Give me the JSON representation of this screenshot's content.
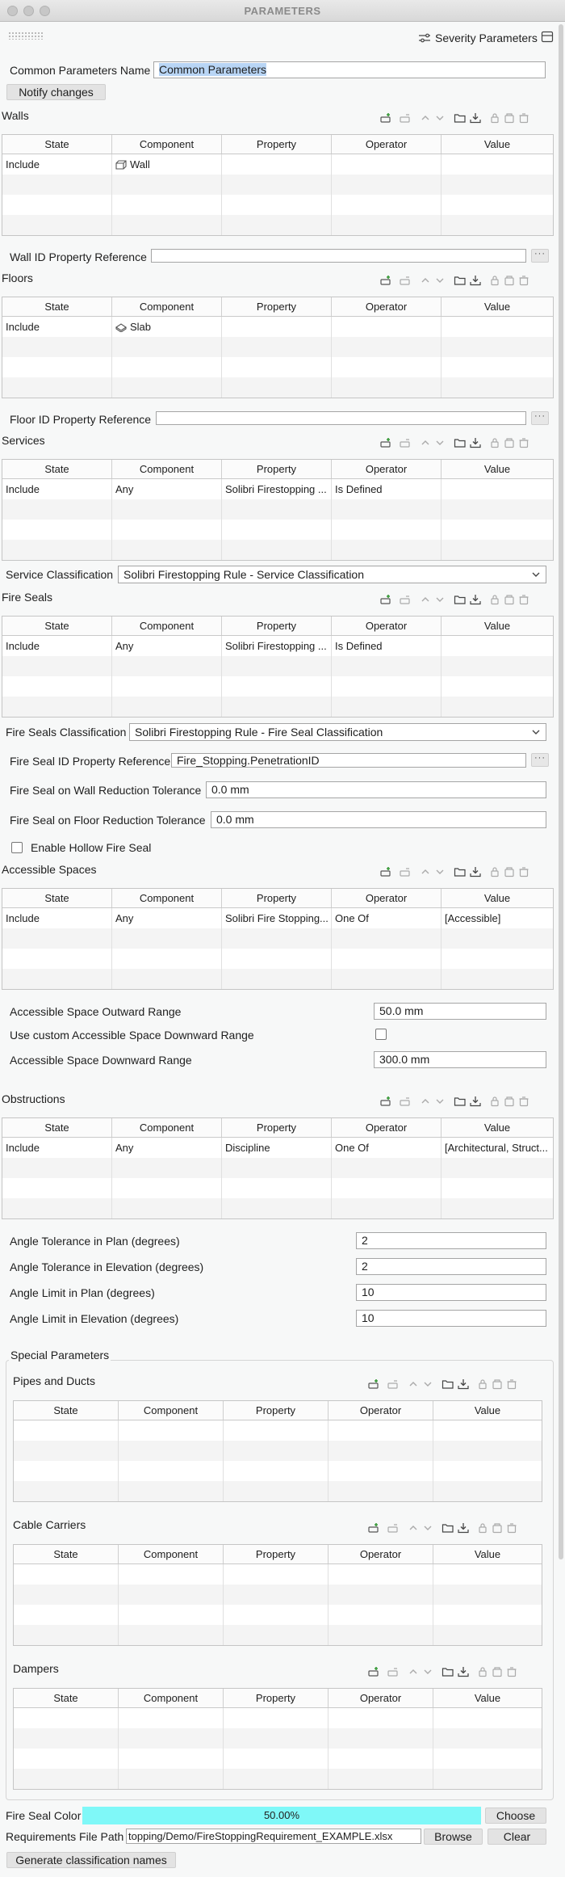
{
  "window": {
    "title": "PARAMETERS",
    "severity_button": "Severity Parameters"
  },
  "common": {
    "label": "Common Parameters Name",
    "value": "Common Parameters",
    "notify_button": "Notify changes"
  },
  "columns": [
    "State",
    "Component",
    "Property",
    "Operator",
    "Value"
  ],
  "tables": {
    "walls": {
      "title": "Walls",
      "rows": [
        [
          "Include",
          "Wall",
          "",
          "",
          ""
        ]
      ]
    },
    "floors": {
      "title": "Floors",
      "rows": [
        [
          "Include",
          "Slab",
          "",
          "",
          ""
        ]
      ]
    },
    "services": {
      "title": "Services",
      "rows": [
        [
          "Include",
          "Any",
          "Solibri Firestopping ...",
          "Is Defined",
          ""
        ]
      ]
    },
    "fire_seals": {
      "title": "Fire Seals",
      "rows": [
        [
          "Include",
          "Any",
          "Solibri Firestopping ...",
          "Is Defined",
          ""
        ]
      ]
    },
    "accessible_spaces": {
      "title": "Accessible Spaces",
      "rows": [
        [
          "Include",
          "Any",
          "Solibri Fire Stopping...",
          "One Of",
          "[Accessible]"
        ]
      ]
    },
    "obstructions": {
      "title": "Obstructions",
      "rows": [
        [
          "Include",
          "Any",
          "Discipline",
          "One Of",
          "[Architectural, Struct..."
        ]
      ]
    },
    "pipes_ducts": {
      "title": "Pipes and Ducts",
      "rows": []
    },
    "cable_carriers": {
      "title": "Cable Carriers",
      "rows": []
    },
    "dampers": {
      "title": "Dampers",
      "rows": []
    }
  },
  "fields": {
    "wall_id_ref": {
      "label": "Wall ID Property Reference",
      "value": ""
    },
    "floor_id_ref": {
      "label": "Floor ID Property Reference",
      "value": ""
    },
    "service_classification": {
      "label": "Service Classification",
      "value": "Solibri Firestopping Rule - Service Classification"
    },
    "fire_seals_classification": {
      "label": "Fire Seals Classification",
      "value": "Solibri Firestopping Rule - Fire Seal Classification"
    },
    "fire_seal_id_ref": {
      "label": "Fire Seal ID Property Reference",
      "value": "Fire_Stopping.PenetrationID"
    },
    "wall_tolerance": {
      "label": "Fire Seal on Wall Reduction Tolerance",
      "value": "0.0 mm"
    },
    "floor_tolerance": {
      "label": "Fire Seal on Floor Reduction Tolerance",
      "value": "0.0 mm"
    },
    "hollow_fire_seal": {
      "label": "Enable Hollow Fire Seal",
      "checked": false
    },
    "outward_range": {
      "label": "Accessible Space Outward Range",
      "value": "50.0 mm"
    },
    "custom_downward": {
      "label": "Use custom Accessible Space Downward Range",
      "checked": false
    },
    "downward_range": {
      "label": "Accessible Space Downward Range",
      "value": "300.0 mm"
    },
    "angle_tol_plan": {
      "label": "Angle Tolerance in Plan (degrees)",
      "value": "2"
    },
    "angle_tol_elev": {
      "label": "Angle Tolerance in Elevation (degrees)",
      "value": "2"
    },
    "angle_lim_plan": {
      "label": "Angle Limit in Plan (degrees)",
      "value": "10"
    },
    "angle_lim_elev": {
      "label": "Angle Limit in Elevation (degrees)",
      "value": "10"
    }
  },
  "special": {
    "title": "Special Parameters"
  },
  "color": {
    "label": "Fire Seal Color",
    "value": "50.00%",
    "fill_fraction": 1.0,
    "swatch": "#7ff8f8",
    "choose_button": "Choose"
  },
  "requirements": {
    "label": "Requirements File Path",
    "value": "topping/Demo/FireStoppingRequirement_EXAMPLE.xlsx",
    "browse_button": "Browse",
    "clear_button": "Clear"
  },
  "generate_button": "Generate classification names",
  "icons": [
    "severity-icon",
    "layout-icon",
    "add-row-icon",
    "remove-row-icon",
    "move-up-icon",
    "move-down-icon",
    "open-folder-icon",
    "import-icon",
    "lock-icon",
    "copy-icon",
    "delete-icon"
  ]
}
